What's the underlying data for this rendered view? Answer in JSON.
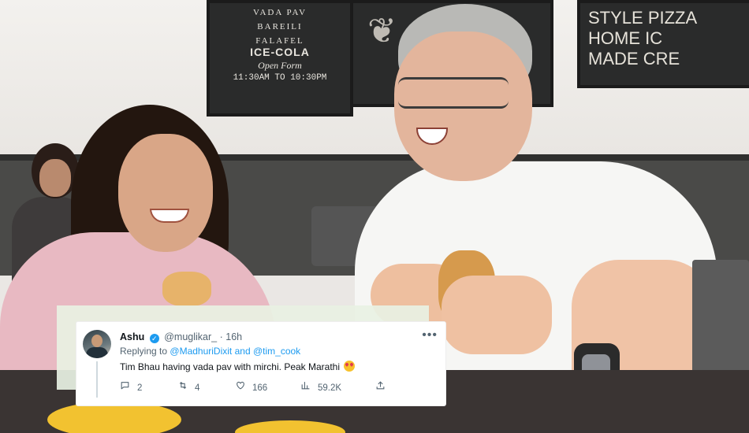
{
  "background": {
    "menu_left": [
      "VADA PAV",
      "BAREILI",
      "FALAFEL",
      "ICE-COLA",
      "Open Form",
      "11:30AM TO 10:30PM"
    ],
    "menu_right": [
      "STYLE",
      "PIZZA",
      "HOME",
      "MADE",
      "IC",
      "CRE"
    ]
  },
  "tweet": {
    "display_name": "Ashu",
    "handle": "@muglikar_",
    "separator": "·",
    "time": "16h",
    "replying_prefix": "Replying to",
    "mention_1": "@MadhuriDixit",
    "replying_and": "and",
    "mention_2": "@tim_cook",
    "text": "Tim Bhau having vada pav with mirchi. Peak Marathi",
    "more_label": "•••",
    "replies": "2",
    "retweets": "4",
    "likes": "166",
    "views": "59.2K"
  },
  "icons": {
    "verified": "verified-badge-icon",
    "emoji": "heart-eyes-emoji-icon",
    "reply": "reply-icon",
    "retweet": "retweet-icon",
    "like": "heart-icon",
    "views": "views-icon",
    "share": "share-icon"
  },
  "colors": {
    "accent": "#1d9bf0",
    "text": "#0f1419",
    "muted": "#536471"
  }
}
